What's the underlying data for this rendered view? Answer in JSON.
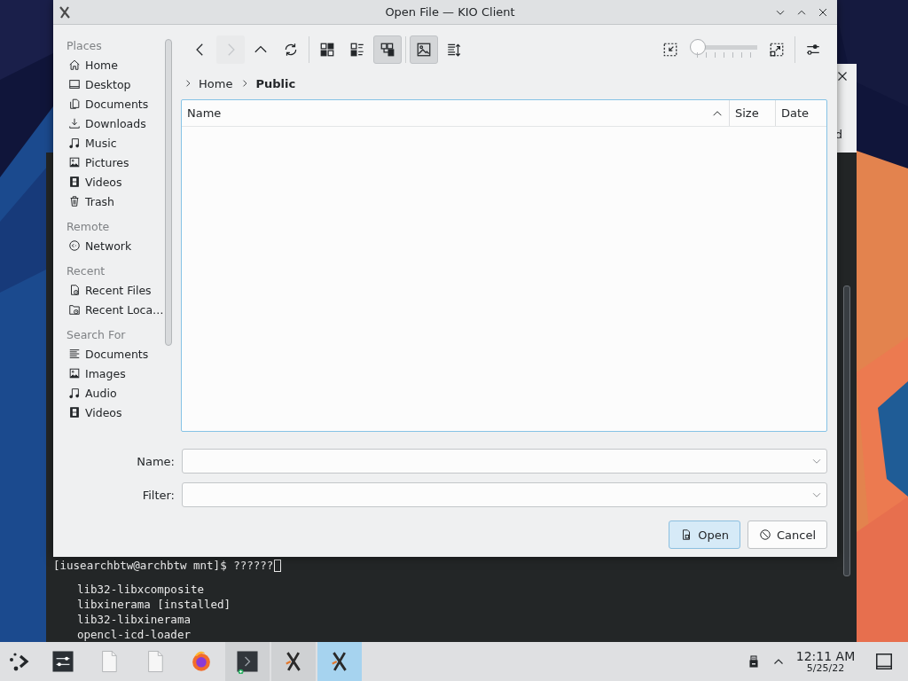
{
  "background_window": {
    "visible_text": "d"
  },
  "terminal": {
    "lines": [
      {
        "kind": "prompt",
        "text": "[iusearchbtw@archbtw mnt]$ ??????"
      },
      {
        "kind": "output",
        "text": "lib32-libxcomposite"
      },
      {
        "kind": "output",
        "text": "libxinerama [installed]"
      },
      {
        "kind": "output",
        "text": "lib32-libxinerama"
      },
      {
        "kind": "output",
        "text": "opencl-icd-loader"
      }
    ]
  },
  "dialog": {
    "title": "Open File — KIO Client",
    "sidebar": {
      "groups": [
        {
          "heading": "Places",
          "items": [
            {
              "kind": "home",
              "label": "Home",
              "selected": false
            },
            {
              "kind": "desktop",
              "label": "Desktop",
              "selected": false
            },
            {
              "kind": "documents",
              "label": "Documents",
              "selected": false
            },
            {
              "kind": "downloads",
              "label": "Downloads",
              "selected": false
            },
            {
              "kind": "music",
              "label": "Music",
              "selected": false
            },
            {
              "kind": "pictures",
              "label": "Pictures",
              "selected": false
            },
            {
              "kind": "videos",
              "label": "Videos",
              "selected": false
            },
            {
              "kind": "trash",
              "label": "Trash",
              "selected": false
            }
          ]
        },
        {
          "heading": "Remote",
          "items": [
            {
              "kind": "network",
              "label": "Network",
              "selected": false
            }
          ]
        },
        {
          "heading": "Recent",
          "items": [
            {
              "kind": "recent_files",
              "label": "Recent Files",
              "selected": false
            },
            {
              "kind": "recent_locations",
              "label": "Recent Loca…",
              "selected": false
            }
          ]
        },
        {
          "heading": "Search For",
          "items": [
            {
              "kind": "text",
              "label": "Documents",
              "selected": false
            },
            {
              "kind": "pictures",
              "label": "Images",
              "selected": false
            },
            {
              "kind": "music",
              "label": "Audio",
              "selected": false
            },
            {
              "kind": "videos",
              "label": "Videos",
              "selected": false
            }
          ]
        }
      ]
    },
    "navigation": [
      {
        "kind": "back",
        "disabled": false
      },
      {
        "kind": "forward",
        "disabled": true
      },
      {
        "kind": "up",
        "disabled": false
      },
      {
        "kind": "reload",
        "disabled": false
      }
    ],
    "view_modes": [
      {
        "kind": "icons",
        "selected": false
      },
      {
        "kind": "compact",
        "selected": false
      },
      {
        "kind": "tree",
        "selected": true
      }
    ],
    "preview": {
      "on": true
    },
    "zoom": {
      "level": 0
    },
    "breadcrumb": [
      {
        "label": "Home",
        "current": false
      },
      {
        "label": "Public",
        "current": true
      }
    ],
    "file_list": {
      "columns": [
        {
          "label": "Name",
          "sorted": true
        },
        {
          "label": "Size",
          "sorted": false
        },
        {
          "label": "Date",
          "sorted": false
        }
      ]
    },
    "fields": [
      {
        "label": "Name:"
      },
      {
        "label": "Filter:"
      }
    ],
    "buttons": [
      {
        "kind": "open",
        "label": "Open",
        "default": true
      },
      {
        "kind": "cancel",
        "label": "Cancel",
        "default": false
      }
    ]
  },
  "taskbar": {
    "tasks": [
      {
        "kind": "settings",
        "open": false,
        "active": false
      },
      {
        "kind": "blank",
        "open": false,
        "active": false
      },
      {
        "kind": "blank",
        "open": false,
        "active": false
      },
      {
        "kind": "browser",
        "open": false,
        "active": false
      },
      {
        "kind": "terminal",
        "open": true,
        "active": false
      },
      {
        "kind": "xapp",
        "open": true,
        "active": false
      },
      {
        "kind": "xapp",
        "open": true,
        "active": true
      }
    ],
    "clock": {
      "time": "12:11 AM",
      "date": "5/25/22"
    }
  }
}
